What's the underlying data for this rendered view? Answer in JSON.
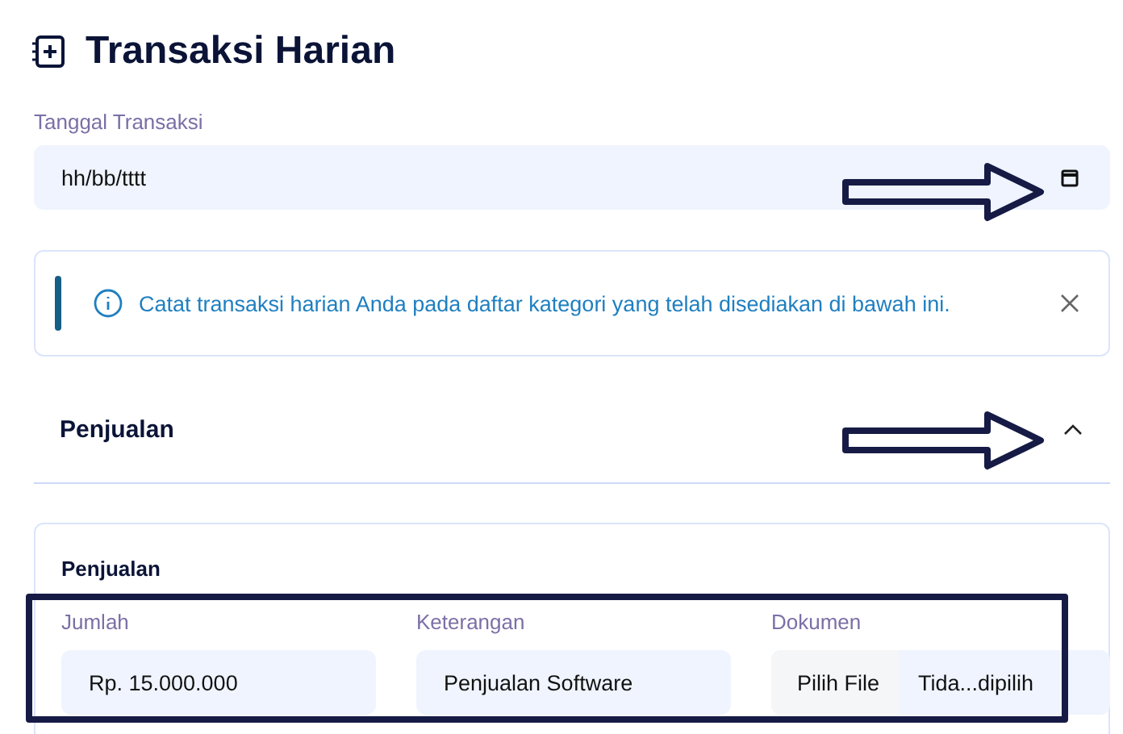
{
  "page": {
    "title": "Transaksi Harian"
  },
  "date_field": {
    "label": "Tanggal Transaksi",
    "value": "hh/bb/tttt"
  },
  "alert": {
    "text": "Catat transaksi harian Anda pada daftar kategori yang telah disediakan di bawah ini."
  },
  "section": {
    "title": "Penjualan",
    "expanded": true
  },
  "card": {
    "title": "Penjualan",
    "fields": [
      {
        "kind": "text",
        "label": "Jumlah",
        "value": "Rp. 15.000.000"
      },
      {
        "kind": "text",
        "label": "Keterangan",
        "value": "Penjualan Software"
      },
      {
        "kind": "file",
        "label": "Dokumen",
        "button": "Pilih File",
        "value": "Tida...dipilih"
      }
    ]
  }
}
